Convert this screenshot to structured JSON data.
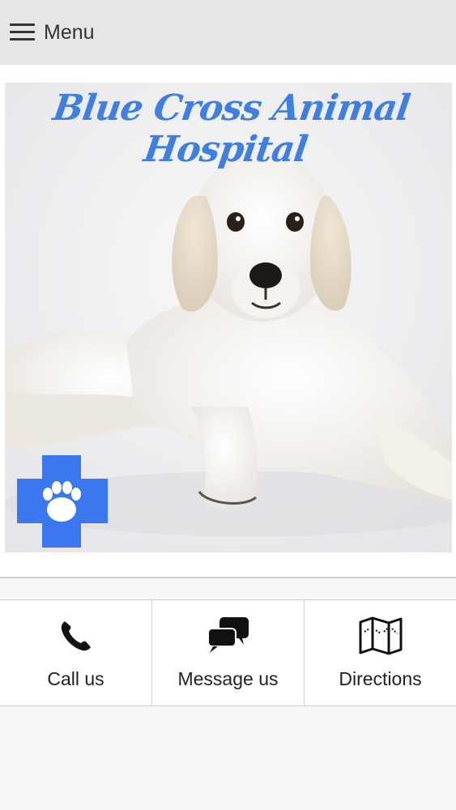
{
  "topbar": {
    "menu_label": "Menu",
    "menu_icon": "hamburger-icon"
  },
  "hero": {
    "title": "Blue Cross Animal Hospital",
    "logo_icon": "blue-cross-paw-icon",
    "accent_color": "#3f7fe0",
    "cross_color": "#3b78f0"
  },
  "actions": [
    {
      "label": "Call us",
      "icon": "phone-icon"
    },
    {
      "label": "Message us",
      "icon": "chat-bubbles-icon"
    },
    {
      "label": "Directions",
      "icon": "map-icon"
    }
  ]
}
